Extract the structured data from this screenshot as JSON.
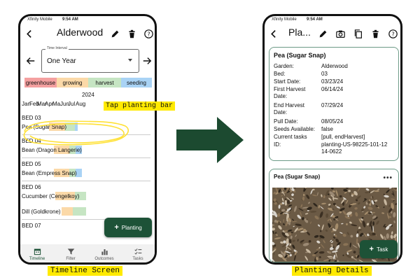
{
  "colors": {
    "greenhouse": "#f4a0a0",
    "growing": "#fbd9a8",
    "harvest": "#c6e5c3",
    "seeding": "#a9d3f5",
    "accent": "#1d5237",
    "highlight": "#ffea00",
    "card_border": "#6c9a86"
  },
  "timeline_screen": {
    "status_bar": {
      "carrier": "Xfinity Mobile",
      "time": "9:54 AM"
    },
    "app_bar": {
      "title": "Alderwood",
      "icons": [
        "back-arrow-icon",
        "pencil-icon",
        "trash-icon",
        "help-icon"
      ]
    },
    "time_interval": {
      "label": "Time Interval",
      "value": "One Year"
    },
    "legend": [
      "greenhouse",
      "growing",
      "harvest",
      "seeding"
    ],
    "year": "2024",
    "months": [
      "Jan",
      "Feb",
      "Mar",
      "Apr",
      "Ma",
      "Jun",
      "Jul",
      "Aug"
    ],
    "beds": [
      {
        "name": "BED 03",
        "crops": [
          {
            "name": "Pea (Sugar Snap)",
            "segments": [
              {
                "stage": "growing",
                "start": 3.5,
                "end": 5.6
              },
              {
                "stage": "harvest",
                "start": 5.6,
                "end": 6.9
              },
              {
                "stage": "seeding",
                "start": 6.9,
                "end": 7.3
              }
            ]
          }
        ]
      },
      {
        "name": "BED 04",
        "crops": [
          {
            "name": "Bean (Dragon Langerie)",
            "segments": [
              {
                "stage": "growing",
                "start": 4.2,
                "end": 6.2
              },
              {
                "stage": "harvest",
                "start": 6.2,
                "end": 7.0
              },
              {
                "stage": "seeding",
                "start": 7.0,
                "end": 7.8
              }
            ]
          }
        ]
      },
      {
        "name": "BED 05",
        "crops": [
          {
            "name": "Bean (Empress Snap)",
            "segments": [
              {
                "stage": "growing",
                "start": 4.2,
                "end": 6.2
              },
              {
                "stage": "harvest",
                "start": 6.2,
                "end": 7.0
              },
              {
                "stage": "seeding",
                "start": 7.0,
                "end": 7.8
              }
            ]
          }
        ]
      },
      {
        "name": "BED 06",
        "crops": [
          {
            "name": "Cucumber (Cengelkoy)",
            "segments": [
              {
                "stage": "growing",
                "start": 4.4,
                "end": 6.9
              },
              {
                "stage": "harvest",
                "start": 6.9,
                "end": 8.4
              }
            ]
          },
          {
            "name": "Dill (Goldkrone)",
            "segments": [
              {
                "stage": "growing",
                "start": 5.2,
                "end": 6.6
              },
              {
                "stage": "harvest",
                "start": 6.6,
                "end": 8.4
              }
            ]
          }
        ]
      },
      {
        "name": "BED 07",
        "crops": []
      }
    ],
    "annotation": "Tap planting bar",
    "fab_label": "Planting",
    "bottom_nav": [
      {
        "label": "Timeline",
        "icon": "calendar-icon",
        "active": true
      },
      {
        "label": "Filter",
        "icon": "filter-icon",
        "active": false
      },
      {
        "label": "Outcomes",
        "icon": "bar-chart-icon",
        "active": false
      },
      {
        "label": "Tasks",
        "icon": "checklist-icon",
        "active": false
      }
    ],
    "caption": "Timeline Screen"
  },
  "details_screen": {
    "status_bar": {
      "carrier": "Xfinity Mobile",
      "time": "9:54 AM"
    },
    "app_bar": {
      "title": "Pla...",
      "icons": [
        "back-arrow-icon",
        "pencil-icon",
        "camera-icon",
        "copy-icon",
        "trash-icon",
        "help-icon"
      ]
    },
    "card": {
      "title": "Pea (Sugar Snap)",
      "fields": [
        {
          "label": "Garden:",
          "value": "Alderwood"
        },
        {
          "label": "Bed:",
          "value": "03"
        },
        {
          "label": "Start Date:",
          "value": "03/23/24"
        },
        {
          "label": "First Harvest Date:",
          "value": "06/14/24"
        },
        {
          "label": "End Harvest Date:",
          "value": "07/29/24"
        },
        {
          "label": "Pull Date:",
          "value": "08/05/24"
        },
        {
          "label": "Seeds Available:",
          "value": "false"
        },
        {
          "label": "Current tasks",
          "value": "[pull, endHarvest]"
        },
        {
          "label": "ID:",
          "value": "planting-US-98225-101-1214-0622"
        }
      ]
    },
    "photo_card": {
      "title": "Pea (Sugar Snap)",
      "menu_icon": "more-horizontal-icon"
    },
    "fab_label": "Task",
    "caption": "Planting Details"
  }
}
